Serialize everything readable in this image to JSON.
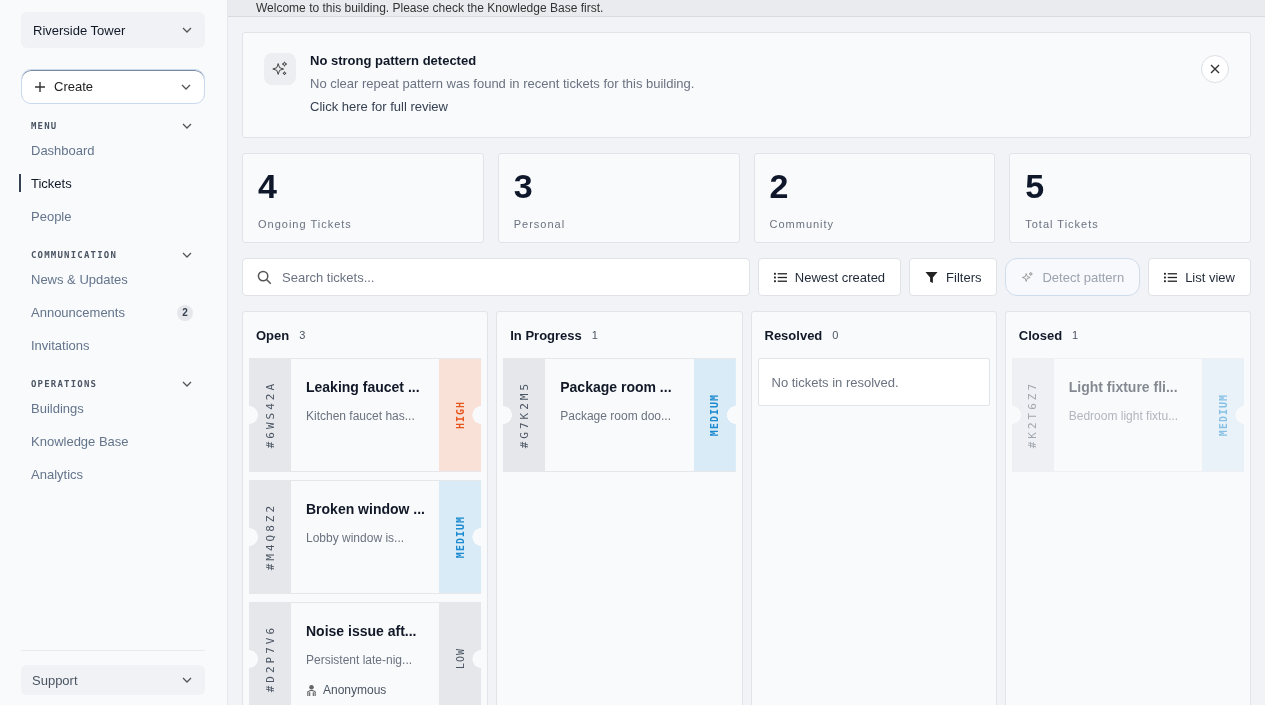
{
  "sidebar": {
    "scope": {
      "value": "Riverside Tower"
    },
    "create_button": {
      "label": "Create"
    },
    "sections": [
      {
        "title": "MENU",
        "expanded": true,
        "items": [
          {
            "label": "Dashboard",
            "selected": false
          },
          {
            "label": "Tickets",
            "selected": true
          },
          {
            "label": "People",
            "selected": false
          }
        ]
      },
      {
        "title": "COMMUNICATION",
        "expanded": true,
        "items": [
          {
            "label": "News & Updates",
            "selected": false
          },
          {
            "label": "Announcements",
            "selected": false,
            "badge": "2"
          },
          {
            "label": "Invitations",
            "selected": false
          }
        ]
      },
      {
        "title": "OPERATIONS",
        "expanded": true,
        "items": [
          {
            "label": "Buildings",
            "selected": false
          },
          {
            "label": "Knowledge Base",
            "selected": false
          },
          {
            "label": "Analytics",
            "selected": false
          }
        ]
      }
    ],
    "footer": {
      "label": "Support"
    }
  },
  "banner": {
    "text": "Welcome to this building. Please check the Knowledge Base first."
  },
  "pattern_card": {
    "title": "No strong pattern detected",
    "text": "No clear repeat pattern was found in recent tickets for this building.",
    "link": "Click here for full review"
  },
  "stats": [
    {
      "value": "4",
      "label": "Ongoing Tickets"
    },
    {
      "value": "3",
      "label": "Personal"
    },
    {
      "value": "2",
      "label": "Community"
    },
    {
      "value": "5",
      "label": "Total Tickets"
    }
  ],
  "toolbar": {
    "search": {
      "placeholder": "Search tickets..."
    },
    "buttons": [
      {
        "kind": "sort",
        "label": "Newest created",
        "disabled": false
      },
      {
        "kind": "filter",
        "label": "Filters",
        "disabled": false
      },
      {
        "kind": "pattern",
        "label": "Detect pattern",
        "disabled": true
      },
      {
        "kind": "view",
        "label": "List view",
        "disabled": false
      }
    ]
  },
  "columns": [
    {
      "title": "Open",
      "count": "3",
      "tickets": [
        {
          "id": "#6WS42A",
          "title": "Leaking faucet ...",
          "description": "Kitchen faucet has...",
          "priority": "HIGH",
          "kind": "high",
          "dimmed": false
        },
        {
          "id": "#M4Q8Z2",
          "title": "Broken window ...",
          "description": "Lobby window is...",
          "priority": "MEDIUM",
          "kind": "medium",
          "dimmed": false
        },
        {
          "id": "#D2P7V6",
          "title": "Noise issue aft...",
          "description": "Persistent late-nig...",
          "priority": "LOW",
          "kind": "low",
          "dimmed": false,
          "reporter": "Anonymous"
        }
      ]
    },
    {
      "title": "In Progress",
      "count": "1",
      "tickets": [
        {
          "id": "#G7K2M5",
          "title": "Package room ...",
          "description": "Package room doo...",
          "priority": "MEDIUM",
          "kind": "medium",
          "dimmed": false
        }
      ]
    },
    {
      "title": "Resolved",
      "count": "0",
      "empty_text": "No tickets in resolved."
    },
    {
      "title": "Closed",
      "count": "1",
      "tickets": [
        {
          "id": "#K2T6Z7",
          "title": "Light fixture fli...",
          "description": "Bedroom light fixtu...",
          "priority": "MEDIUM",
          "kind": "medium",
          "dimmed": true
        }
      ]
    }
  ]
}
